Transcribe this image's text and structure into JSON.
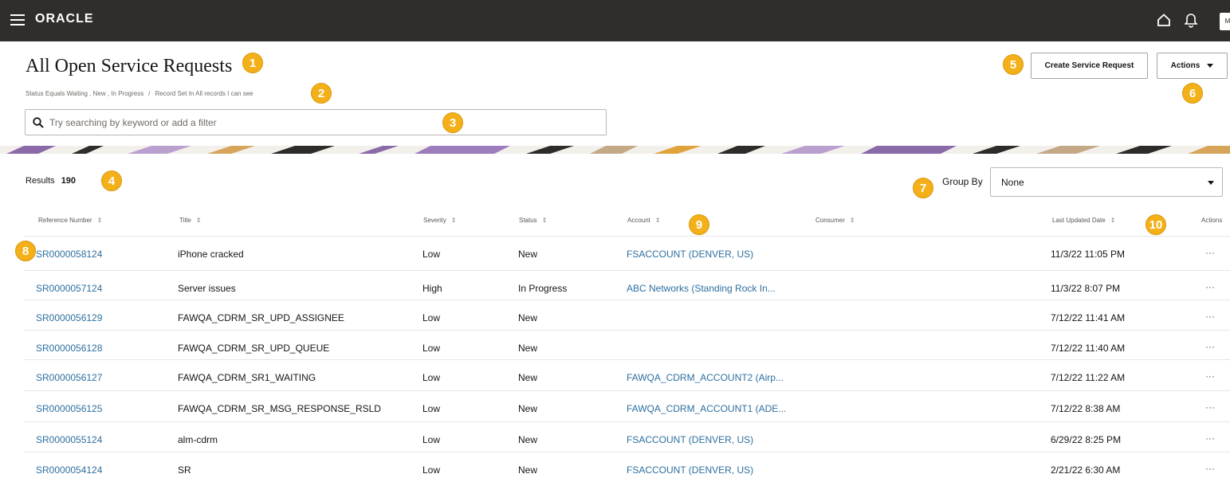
{
  "app": {
    "logo": "ORACLE",
    "avatar_initials": "M"
  },
  "page": {
    "title": "All Open Service Requests",
    "filter_status": "Status Equals Waiting , New , In Progress",
    "filter_separator": "/",
    "filter_recordset": "Record Set In All records I can see"
  },
  "search": {
    "placeholder": "Try searching by keyword or add a filter"
  },
  "toolbar": {
    "create_label": "Create Service Request",
    "actions_label": "Actions"
  },
  "results": {
    "label": "Results",
    "count": "190"
  },
  "group_by": {
    "label": "Group By",
    "value": "None"
  },
  "table": {
    "headers": {
      "reference": "Reference Number",
      "title": "Title",
      "severity": "Severity",
      "status": "Status",
      "account": "Account",
      "consumer": "Consumer",
      "updated": "Last Updated Date",
      "actions": "Actions"
    },
    "sort_glyph": "⇕",
    "rows": [
      {
        "ref": "SR0000058124",
        "title": "iPhone cracked",
        "severity": "Low",
        "status": "New",
        "account": "FSACCOUNT (DENVER, US)",
        "updated": "11/3/22 11:05 PM",
        "actions": "···"
      },
      {
        "ref": "SR0000057124",
        "title": "Server issues",
        "severity": "High",
        "status": "In Progress",
        "account": "ABC Networks (Standing Rock In...",
        "updated": "11/3/22 8:07 PM",
        "actions": "···"
      },
      {
        "ref": "SR0000056129",
        "title": "FAWQA_CDRM_SR_UPD_ASSIGNEE",
        "severity": "Low",
        "status": "New",
        "account": "",
        "updated": "7/12/22 11:41 AM",
        "actions": "···"
      },
      {
        "ref": "SR0000056128",
        "title": "FAWQA_CDRM_SR_UPD_QUEUE",
        "severity": "Low",
        "status": "New",
        "account": "",
        "updated": "7/12/22 11:40 AM",
        "actions": "···"
      },
      {
        "ref": "SR0000056127",
        "title": "FAWQA_CDRM_SR1_WAITING",
        "severity": "Low",
        "status": "New",
        "account": "FAWQA_CDRM_ACCOUNT2 (Airp...",
        "updated": "7/12/22 11:22 AM",
        "actions": "···"
      },
      {
        "ref": "SR0000056125",
        "title": "FAWQA_CDRM_SR_MSG_RESPONSE_RSLD",
        "severity": "Low",
        "status": "New",
        "account": "FAWQA_CDRM_ACCOUNT1 (ADE...",
        "updated": "7/12/22 8:38 AM",
        "actions": "···"
      },
      {
        "ref": "SR0000055124",
        "title": "alm-cdrm",
        "severity": "Low",
        "status": "New",
        "account": "FSACCOUNT (DENVER, US)",
        "updated": "6/29/22 8:25 PM",
        "actions": "···"
      },
      {
        "ref": "SR0000054124",
        "title": "SR",
        "severity": "Low",
        "status": "New",
        "account": "FSACCOUNT (DENVER, US)",
        "updated": "2/21/22 6:30 AM",
        "actions": "···"
      }
    ]
  },
  "callouts": {
    "n1": "1",
    "n2": "2",
    "n3": "3",
    "n4": "4",
    "n5": "5",
    "n6": "6",
    "n7": "7",
    "n8": "8",
    "n9": "9",
    "n10": "10"
  },
  "colors": {
    "header_bg": "#312d2a",
    "link": "#2d6f9f",
    "callout": "#f4b019"
  }
}
